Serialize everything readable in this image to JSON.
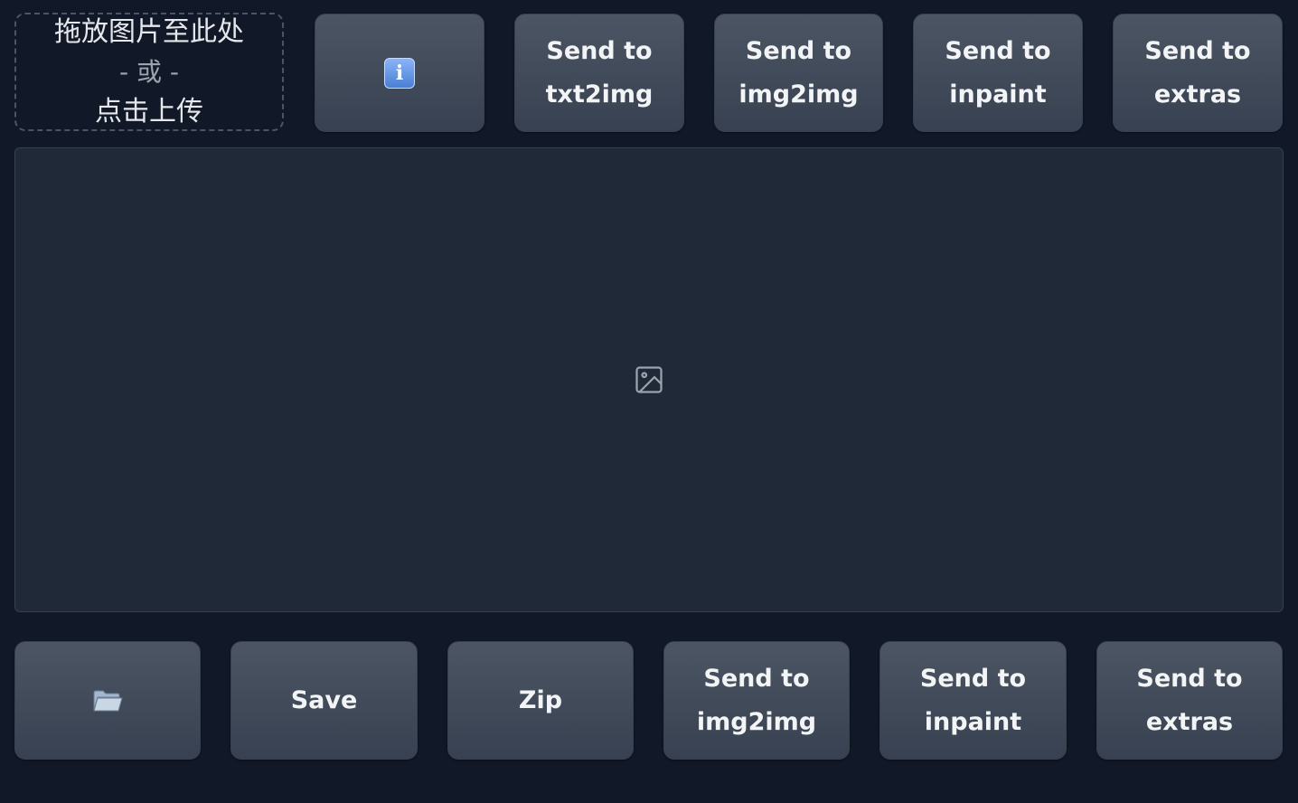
{
  "upload": {
    "line1": "拖放图片至此处",
    "line2": "- 或 -",
    "line3": "点击上传"
  },
  "top_buttons": {
    "info_icon": "info-icon",
    "txt2img": [
      "Send to",
      "txt2img"
    ],
    "img2img": [
      "Send to",
      "img2img"
    ],
    "inpaint": [
      "Send to",
      "inpaint"
    ],
    "extras": [
      "Send to",
      "extras"
    ]
  },
  "gallery": {
    "placeholder_icon": "image-icon"
  },
  "bottom_buttons": {
    "folder_icon": "folder-icon",
    "save": "Save",
    "zip": "Zip",
    "img2img": [
      "Send to",
      "img2img"
    ],
    "inpaint": [
      "Send to",
      "inpaint"
    ],
    "extras": [
      "Send to",
      "extras"
    ]
  },
  "colors": {
    "background": "#111827",
    "panel": "#1f2937",
    "button_top": "#4b5563",
    "button_bottom": "#374151",
    "text": "#f3f4f6"
  }
}
